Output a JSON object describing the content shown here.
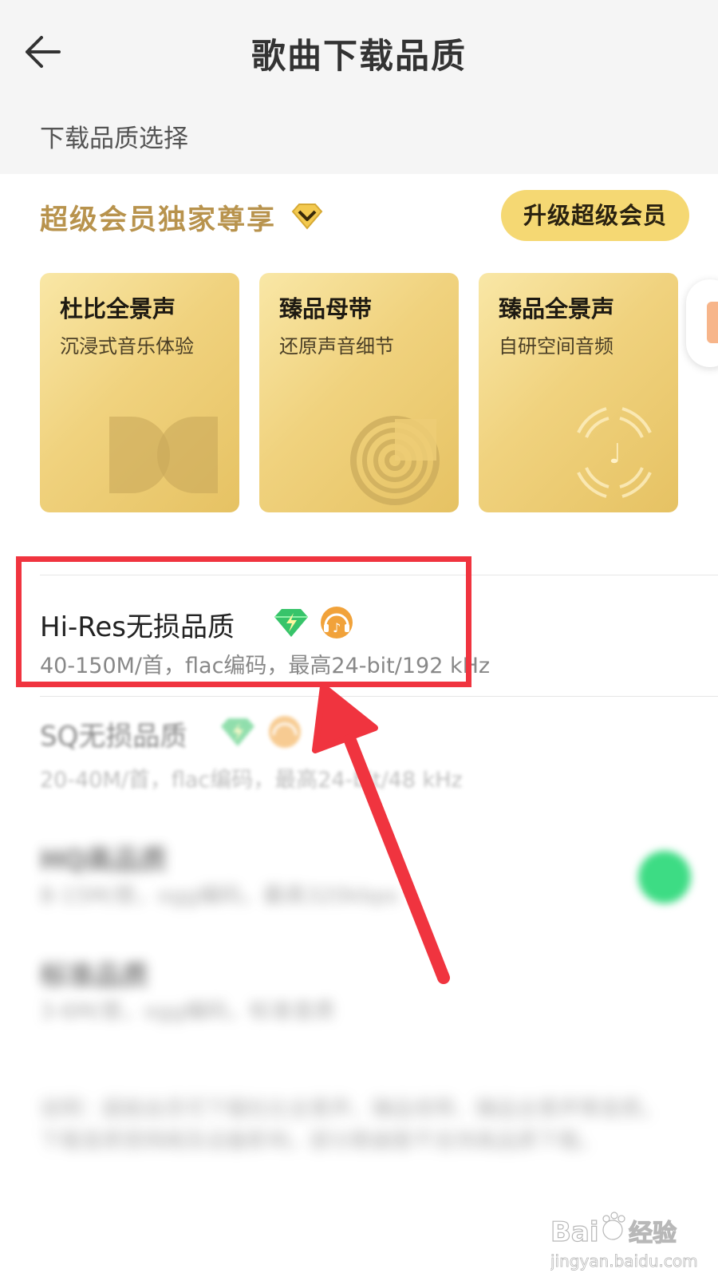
{
  "header": {
    "title": "歌曲下载品质"
  },
  "section_label": "下载品质选择",
  "vip": {
    "title": "超级会员独家尊享",
    "upgrade_label": "升级超级会员",
    "cards": [
      {
        "title": "杜比全景声",
        "subtitle": "沉浸式音乐体验"
      },
      {
        "title": "臻品母带",
        "subtitle": "还原声音细节"
      },
      {
        "title": "臻品全景声",
        "subtitle": "自研空间音频"
      }
    ]
  },
  "qualities": [
    {
      "title": "Hi-Res无损品质",
      "subtitle": "40-150M/首，flac编码，最高24-bit/192 kHz",
      "highlighted": true
    },
    {
      "title": "SQ无损品质",
      "subtitle": "20-40M/首，flac编码，最高24-bit/48 kHz"
    },
    {
      "title": "HQ高品质",
      "subtitle": "8-15M/首，ogg编码，最高320kbps",
      "selected": true
    },
    {
      "title": "标准品质",
      "subtitle": "3-6M/首，ogg编码，标准音质"
    }
  ],
  "tips": "说明：超级会员可下载杜比全景声、臻品母带、臻品全景声等音质。下载音质受网络及设备影响，部分歌曲暂不支持高品质下载。",
  "watermark": {
    "brand": "Bai 经验",
    "url": "jingyan.baidu.com"
  },
  "colors": {
    "vip_gold": "#b8934d",
    "upgrade_button": "#f5d873",
    "highlight": "#f0343f",
    "selected_green": "#3ddc84"
  },
  "icons": [
    "back-arrow-icon",
    "vip-diamond-icon",
    "green-gem-icon",
    "orange-headphone-icon"
  ]
}
